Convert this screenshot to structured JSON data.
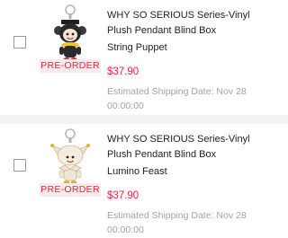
{
  "cart": {
    "items": [
      {
        "title_line1": "WHY SO SERIOUS Series-Vinyl",
        "title_line2": "Plush Pendant Blind Box",
        "variant": "String Puppet",
        "badge": "PRE-ORDER",
        "price": "$37.90",
        "shipping_line1": "Estimated Shipping Date: Nov 28",
        "shipping_line2": "00:00:00",
        "checked": false
      },
      {
        "title_line1": "WHY SO SERIOUS Series-Vinyl",
        "title_line2": "Plush Pendant Blind Box",
        "variant": "Lumino Feast",
        "badge": "PRE-ORDER",
        "price": "$37.90",
        "shipping_line1": "Estimated Shipping Date: Nov 28",
        "shipping_line2": "00:00:00",
        "checked": false
      }
    ]
  },
  "colors": {
    "accent": "#e5273f",
    "badge_bg": "#fde9ec",
    "muted_text": "#a3a3a3",
    "divider": "#f3f3f3"
  },
  "icons": {
    "item_1_image": "string-puppet-pendant-figure",
    "item_2_image": "lumino-feast-pendant-figure"
  }
}
